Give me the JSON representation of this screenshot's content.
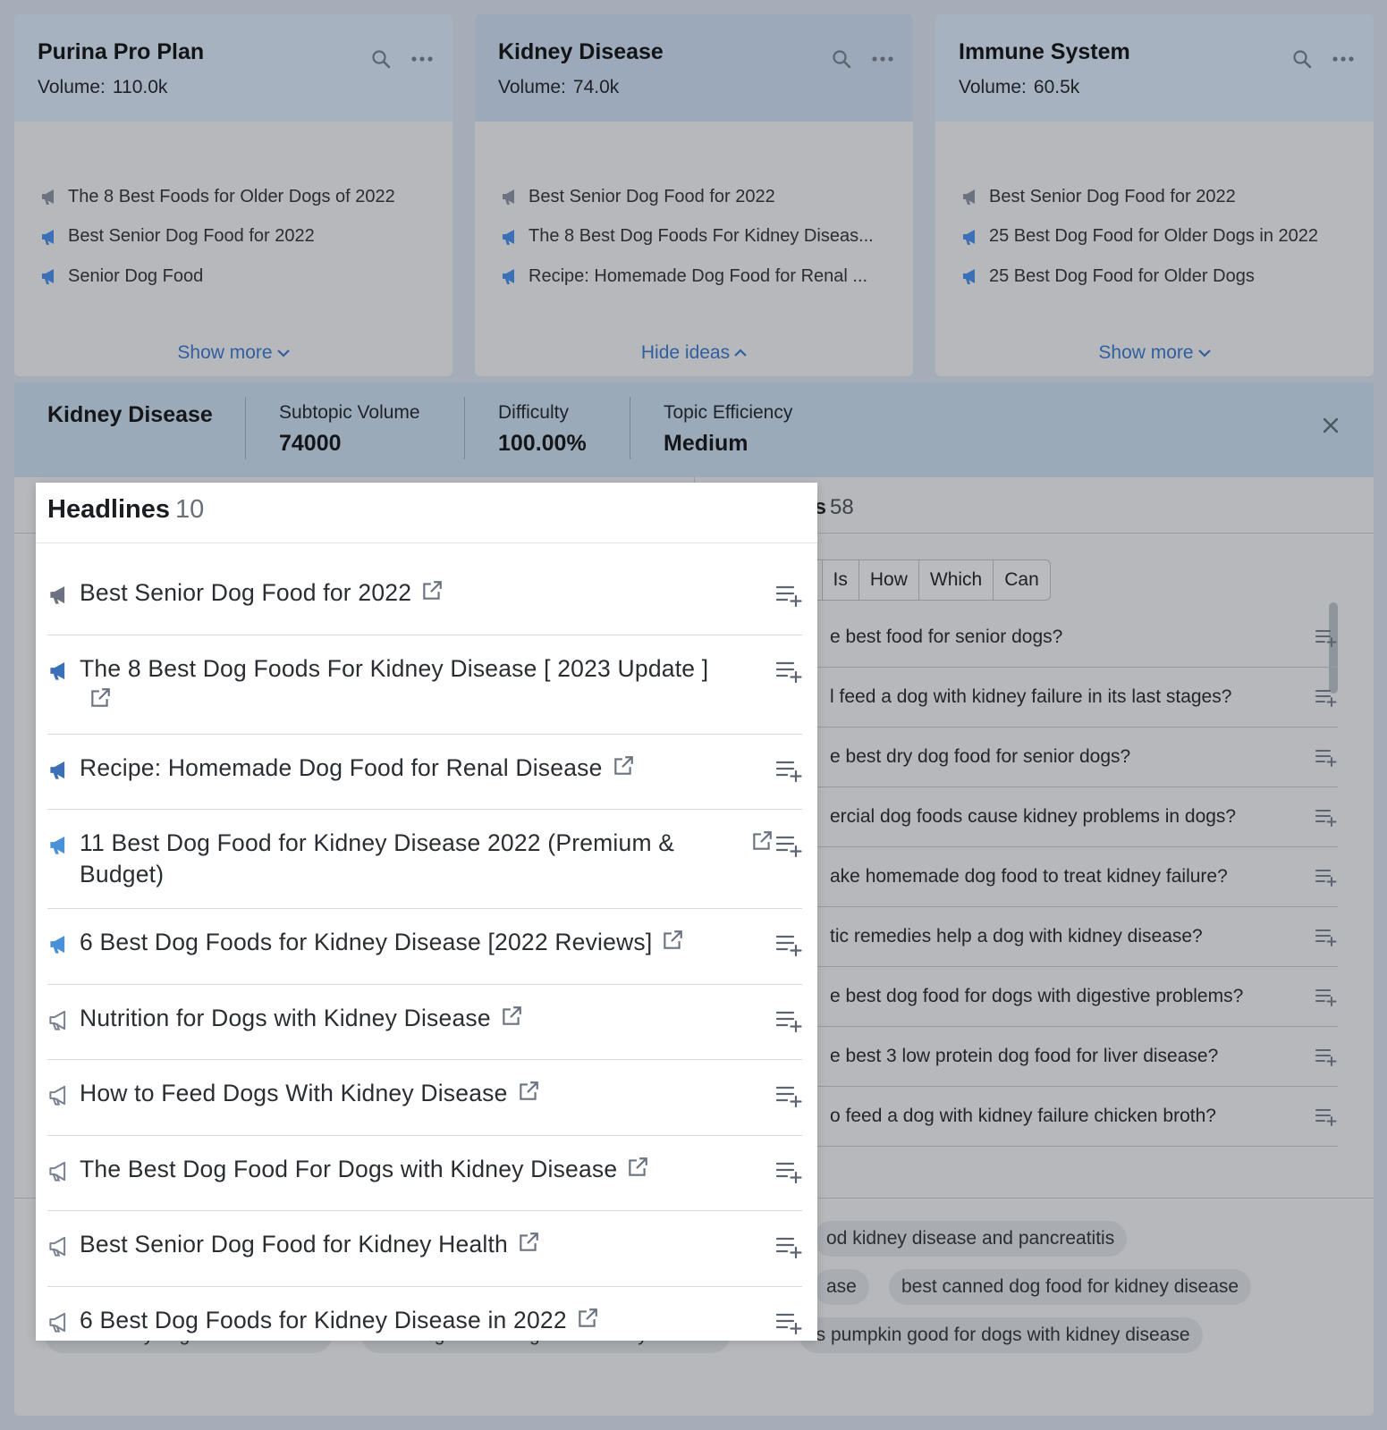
{
  "cards": [
    {
      "title": "Purina Pro Plan",
      "volume_label": "Volume:",
      "volume_value": "110.0k",
      "ideas": [
        {
          "text": "The 8 Best Foods for Older Dogs of 2022",
          "icon": "megaphone-gray-icon"
        },
        {
          "text": "Best Senior Dog Food for 2022",
          "icon": "megaphone-blue-icon"
        },
        {
          "text": "Senior Dog Food",
          "icon": "megaphone-blue-icon"
        }
      ],
      "toggle_label": "Show more"
    },
    {
      "title": "Kidney Disease",
      "volume_label": "Volume:",
      "volume_value": "74.0k",
      "ideas": [
        {
          "text": "Best Senior Dog Food for 2022",
          "icon": "megaphone-gray-icon"
        },
        {
          "text": "The 8 Best Dog Foods For Kidney Diseas...",
          "icon": "megaphone-blue-icon"
        },
        {
          "text": "Recipe: Homemade Dog Food for Renal ...",
          "icon": "megaphone-blue-icon"
        }
      ],
      "toggle_label": "Hide ideas"
    },
    {
      "title": "Immune System",
      "volume_label": "Volume:",
      "volume_value": "60.5k",
      "ideas": [
        {
          "text": "Best Senior Dog Food for 2022",
          "icon": "megaphone-gray-icon"
        },
        {
          "text": "25 Best Dog Food for Older Dogs in 2022",
          "icon": "megaphone-blue-icon"
        },
        {
          "text": "25 Best Dog Food for Older Dogs",
          "icon": "megaphone-blue-icon"
        }
      ],
      "toggle_label": "Show more"
    }
  ],
  "infobar": {
    "topic": "Kidney Disease",
    "subtopic_volume_label": "Subtopic Volume",
    "subtopic_volume_value": "74000",
    "difficulty_label": "Difficulty",
    "difficulty_value": "100.00%",
    "efficiency_label": "Topic Efficiency",
    "efficiency_value": "Medium"
  },
  "questions": {
    "title_visible": "ns",
    "count": "58",
    "filters": [
      "at",
      "Is",
      "How",
      "Which",
      "Can"
    ],
    "items": [
      "e best food for senior dogs?",
      "l feed a dog with kidney failure in its last stages?",
      "e best dry dog food for senior dogs?",
      "ercial dog foods cause kidney problems in dogs?",
      "ake homemade dog food to treat kidney failure?",
      "tic remedies help a dog with kidney disease?",
      "e best dog food for dogs with digestive problems?",
      "e best 3 low protein dog food for liver disease?",
      "o feed a dog with kidney failure chicken broth?"
    ]
  },
  "related_searches": [
    "od kidney disease and pancreatitis",
    "ase",
    "best canned dog food for kidney disease",
    "can healthy dogs eat renal food",
    "is tuna good for dogs with kidney disease",
    "is pumpkin good for dogs with kidney disease"
  ],
  "headlines": {
    "title": "Headlines",
    "count": "10",
    "items": [
      {
        "text": "Best Senior Dog Food for 2022",
        "icon": "megaphone-gray-filled-icon"
      },
      {
        "text": "The 8 Best Dog Foods For Kidney Disease [ 2023 Update ]",
        "icon": "megaphone-blue-filled-icon"
      },
      {
        "text": "Recipe: Homemade Dog Food for Renal Disease",
        "icon": "megaphone-blue-filled-icon"
      },
      {
        "text": "11 Best Dog Food for Kidney Disease 2022 (Premium & Budget)",
        "icon": "megaphone-lightblue-icon"
      },
      {
        "text": "6 Best Dog Foods for Kidney Disease [2022 Reviews]",
        "icon": "megaphone-lightblue-icon"
      },
      {
        "text": "Nutrition for Dogs with Kidney Disease",
        "icon": "megaphone-outline-icon"
      },
      {
        "text": "How to Feed Dogs With Kidney Disease",
        "icon": "megaphone-outline-icon"
      },
      {
        "text": "The Best Dog Food For Dogs with Kidney Disease",
        "icon": "megaphone-outline-icon"
      },
      {
        "text": "Best Senior Dog Food for Kidney Health",
        "icon": "megaphone-outline-icon"
      },
      {
        "text": "6 Best Dog Foods for Kidney Disease in 2022",
        "icon": "megaphone-outline-icon"
      }
    ]
  },
  "colors": {
    "accent_blue": "#2f5fa0",
    "megaphone_blue": "#3b6fb6",
    "megaphone_lightblue": "#4a90d9",
    "megaphone_gray": "#6b7380"
  }
}
